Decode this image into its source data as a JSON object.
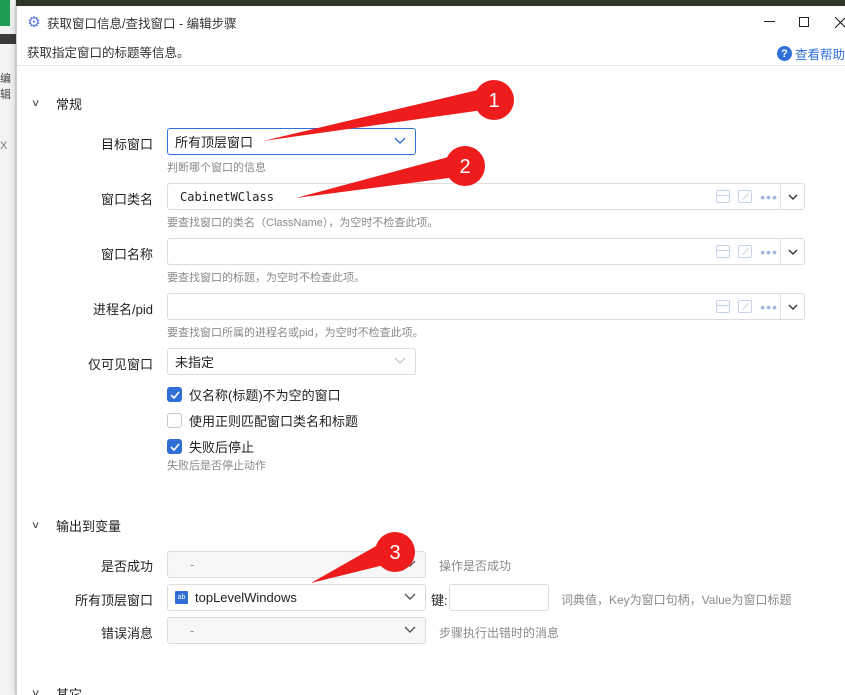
{
  "background": {
    "fragments": [
      "编辑",
      "X",
      "X"
    ]
  },
  "titlebar": {
    "title": "获取窗口信息/查找窗口 - 编辑步骤",
    "icon": "gear-icon"
  },
  "description": "获取指定窗口的标题等信息。",
  "help_label": "查看帮助",
  "sections": {
    "general": "常规",
    "output": "输出到变量",
    "other": "其它"
  },
  "general": {
    "target_window": {
      "label": "目标窗口",
      "value": "所有顶层窗口",
      "hint": "判断哪个窗口的信息"
    },
    "class_name": {
      "label": "窗口类名",
      "value": "CabinetWClass",
      "hint": "要查找窗口的类名（ClassName），为空时不检查此项。"
    },
    "window_name": {
      "label": "窗口名称",
      "value": "",
      "hint": "要查找窗口的标题，为空时不检查此项。"
    },
    "process": {
      "label": "进程名/pid",
      "value": "",
      "hint": "要查找窗口所属的进程名或pid，为空时不检查此项。"
    },
    "visible_only": {
      "label": "仅可见窗口",
      "value": "未指定"
    },
    "checkboxes": [
      {
        "label": "仅名称(标题)不为空的窗口",
        "checked": true
      },
      {
        "label": "使用正则匹配窗口类名和标题",
        "checked": false
      },
      {
        "label": "失败后停止",
        "checked": true
      }
    ],
    "stop_hint": "失败后是否停止动作"
  },
  "output": {
    "success": {
      "label": "是否成功",
      "value": "-",
      "hint": "操作是否成功"
    },
    "all_windows": {
      "label": "所有顶层窗口",
      "value": "topLevelWindows",
      "key_label": "键:",
      "key_value": "",
      "hint": "词典值，Key为窗口句柄，Value为窗口标题"
    },
    "error": {
      "label": "错误消息",
      "value": "-",
      "hint": "步骤执行出错时的消息"
    }
  },
  "annotations": [
    "1",
    "2",
    "3"
  ],
  "colors": {
    "accent": "#2f6fd6",
    "annotation_red": "#ee1c1c"
  }
}
